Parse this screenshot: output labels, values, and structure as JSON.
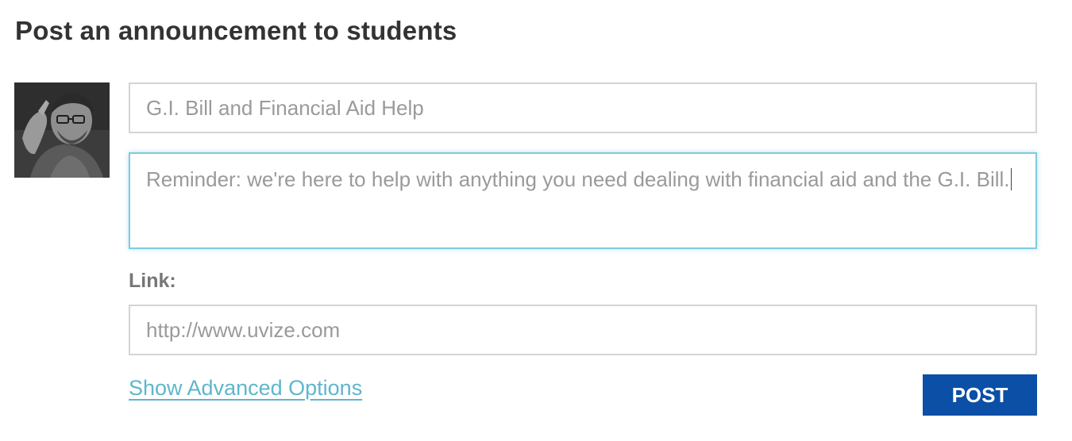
{
  "heading": "Post an announcement to students",
  "avatar": {
    "icon": "user-photo"
  },
  "form": {
    "subject_value": "G.I. Bill and Financial Aid Help",
    "message_value": "Reminder: we're here to help with anything you need dealing with financial aid and the G.I. Bill.",
    "link_label": "Link:",
    "link_value": "http://www.uvize.com",
    "advanced_label": "Show Advanced Options",
    "post_label": "POST"
  },
  "colors": {
    "accent_link": "#5fb6cc",
    "focus_border": "#7ecbe0",
    "button_bg": "#0b4fa6"
  }
}
